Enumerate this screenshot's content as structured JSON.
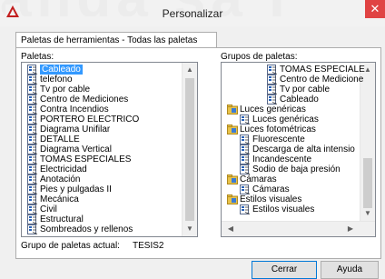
{
  "window": {
    "title": "Personalizar",
    "bg_text": "anda sa I"
  },
  "tab": {
    "label": "Paletas de herramientas - Todas las paletas"
  },
  "palettes": {
    "label": "Paletas:",
    "selected": "Cableado",
    "items": [
      "Cableado",
      "telefono",
      "Tv por cable",
      "Centro de Mediciones",
      "Contra Incendios",
      "PORTERO ELECTRICO",
      "Diagrama Unifilar",
      "DETALLE",
      "Diagrama Vertical",
      "TOMAS ESPECIALES",
      "Electricidad",
      "Anotación",
      "Pies y pulgadas II",
      "Mecánica",
      "Civil",
      "Estructural",
      "Sombreados y rellenos"
    ]
  },
  "groups": {
    "label": "Grupos de paletas:",
    "items": [
      {
        "text": "TOMAS ESPECIALE",
        "level": 2,
        "kind": "palette"
      },
      {
        "text": "Centro de Medicione",
        "level": 2,
        "kind": "palette"
      },
      {
        "text": "Tv por cable",
        "level": 2,
        "kind": "palette"
      },
      {
        "text": "Cableado",
        "level": 2,
        "kind": "palette"
      },
      {
        "text": "Luces genéricas",
        "level": 0,
        "kind": "group"
      },
      {
        "text": "Luces genéricas",
        "level": 1,
        "kind": "palette"
      },
      {
        "text": "Luces fotométricas",
        "level": 0,
        "kind": "group"
      },
      {
        "text": "Fluorescente",
        "level": 1,
        "kind": "palette"
      },
      {
        "text": "Descarga de alta intensio",
        "level": 1,
        "kind": "palette"
      },
      {
        "text": "Incandescente",
        "level": 1,
        "kind": "palette"
      },
      {
        "text": "Sodio de baja presión",
        "level": 1,
        "kind": "palette"
      },
      {
        "text": "Cámaras",
        "level": 0,
        "kind": "group"
      },
      {
        "text": "Cámaras",
        "level": 1,
        "kind": "palette"
      },
      {
        "text": "Estilos visuales",
        "level": 0,
        "kind": "group"
      },
      {
        "text": "Estilos visuales",
        "level": 1,
        "kind": "palette"
      }
    ]
  },
  "current_group": {
    "label": "Grupo de paletas actual:",
    "value": "TESIS2"
  },
  "buttons": {
    "close": "Cerrar",
    "help": "Ayuda"
  },
  "colors": {
    "selection": "#3399ff",
    "close_button": "#e04343"
  }
}
